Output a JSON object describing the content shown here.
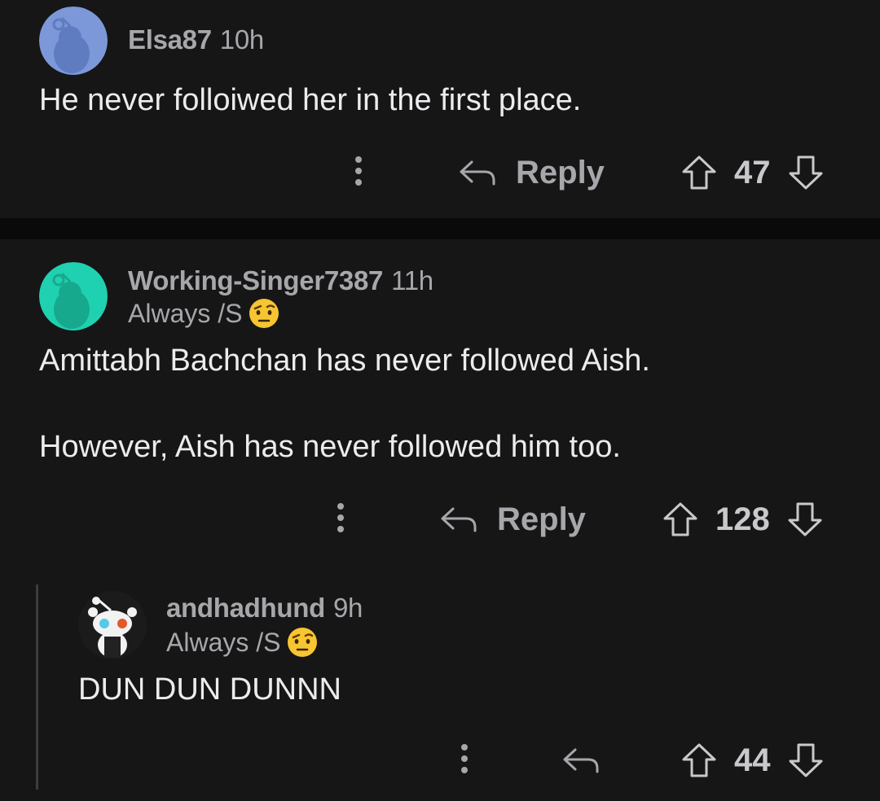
{
  "comments": [
    {
      "username": "Elsa87",
      "age": "10h",
      "flair": "",
      "body": [
        "He never folloiwed her in the first place."
      ],
      "reply_label": "Reply",
      "votes": "47",
      "avatar_color": "#7c98d8"
    },
    {
      "username": "Working-Singer7387",
      "age": "11h",
      "flair": "Always /S",
      "flair_emoji": "face-with-raised-eyebrow",
      "body": [
        "Amittabh Bachchan has never followed Aish.",
        "However, Aish has never followed him too."
      ],
      "reply_label": "Reply",
      "votes": "128",
      "avatar_color": "#1fd1b0"
    },
    {
      "username": "andhadhund",
      "age": "9h",
      "flair": "Always /S",
      "flair_emoji": "face-with-raised-eyebrow",
      "body": [
        "DUN DUN DUNNN"
      ],
      "reply_label": "",
      "votes": "44",
      "avatar_color": "#f2f2f2"
    }
  ],
  "icons": {
    "more": "more-vertical-icon",
    "reply": "reply-arrow-icon",
    "upvote": "upvote-arrow-icon",
    "downvote": "downvote-arrow-icon"
  }
}
